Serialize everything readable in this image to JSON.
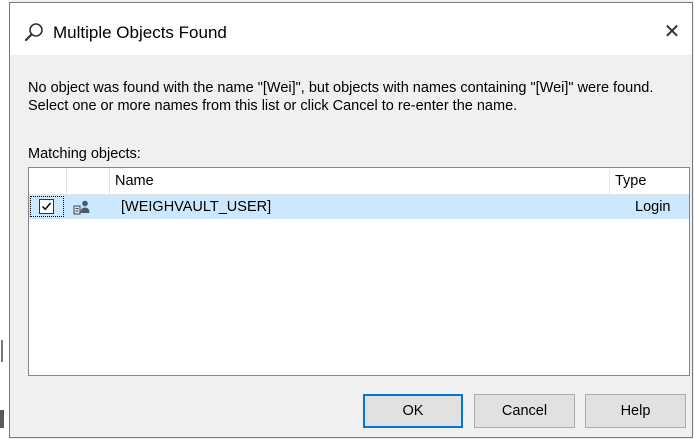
{
  "dialog": {
    "title": "Multiple Objects Found",
    "close_glyph": "✕",
    "message": "No object was found with the name \"[Wei]\", but objects with names containing \"[Wei]\" were found.  Select one or more names from this list or click Cancel to re-enter the name.",
    "matching_label": "Matching objects:",
    "columns": {
      "name": "Name",
      "type": "Type"
    },
    "rows": [
      {
        "checked": true,
        "icon": "login-user-icon",
        "name": "[WEIGHVAULT_USER]",
        "type": "Login"
      }
    ],
    "buttons": {
      "ok": "OK",
      "cancel": "Cancel",
      "help": "Help"
    }
  },
  "colors": {
    "selection": "#cce8ff",
    "default_button_border": "#0078d7"
  }
}
